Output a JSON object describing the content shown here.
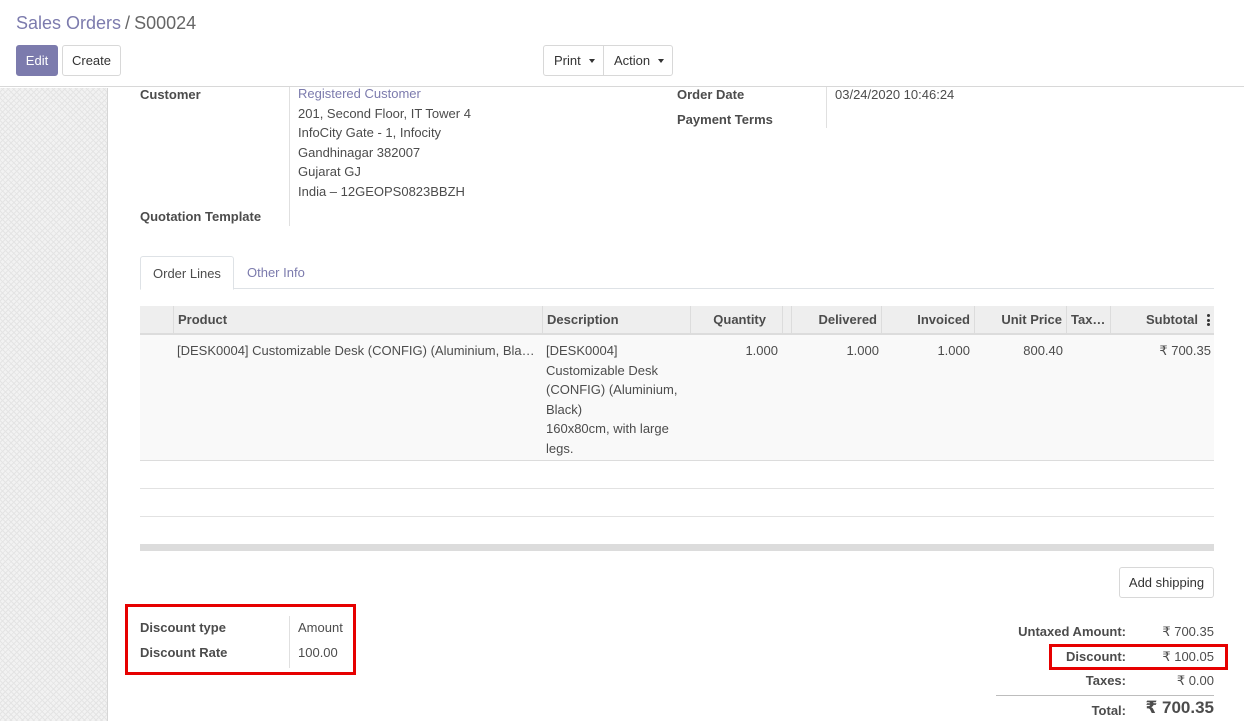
{
  "breadcrumb": {
    "parent": "Sales Orders",
    "separator": "/",
    "current": "S00024"
  },
  "buttons": {
    "edit": "Edit",
    "create": "Create",
    "print": "Print",
    "action": "Action"
  },
  "form": {
    "customer_label": "Customer",
    "customer_name": "Registered Customer",
    "customer_address": [
      "201, Second Floor, IT Tower 4",
      "InfoCity Gate - 1, Infocity",
      "Gandhinagar 382007",
      "Gujarat GJ",
      "India – 12GEOPS0823BBZH"
    ],
    "quotation_template_label": "Quotation Template",
    "order_date_label": "Order Date",
    "order_date_value": "03/24/2020 10:46:24",
    "payment_terms_label": "Payment Terms"
  },
  "tabs": [
    {
      "label": "Order Lines",
      "active": true
    },
    {
      "label": "Other Info",
      "active": false
    }
  ],
  "table": {
    "columns": [
      "Product",
      "Description",
      "Quantity",
      "Delivered",
      "Invoiced",
      "Unit Price",
      "Tax…",
      "Subtotal"
    ],
    "rows": [
      {
        "product": "[DESK0004] Customizable Desk (CONFIG) (Aluminium, Bla…",
        "description": [
          "[DESK0004]",
          "Customizable Desk",
          "(CONFIG) (Aluminium,",
          "Black)",
          "160x80cm, with large",
          "legs."
        ],
        "quantity": "1.000",
        "delivered": "1.000",
        "invoiced": "1.000",
        "unit_price": "800.40",
        "taxes": "",
        "subtotal": "₹ 700.35"
      }
    ]
  },
  "add_shipping": "Add shipping",
  "discount": {
    "type_label": "Discount type",
    "type_value": "Amount",
    "rate_label": "Discount Rate",
    "rate_value": "100.00"
  },
  "totals": {
    "untaxed_label": "Untaxed Amount:",
    "untaxed_value": "₹ 700.35",
    "discount_label": "Discount:",
    "discount_value": "₹ 100.05",
    "taxes_label": "Taxes:",
    "taxes_value": "₹ 0.00",
    "total_label": "Total:",
    "total_value": "₹ 700.35"
  },
  "colors": {
    "brand": "#7c7bad",
    "highlight": "#e60000"
  }
}
